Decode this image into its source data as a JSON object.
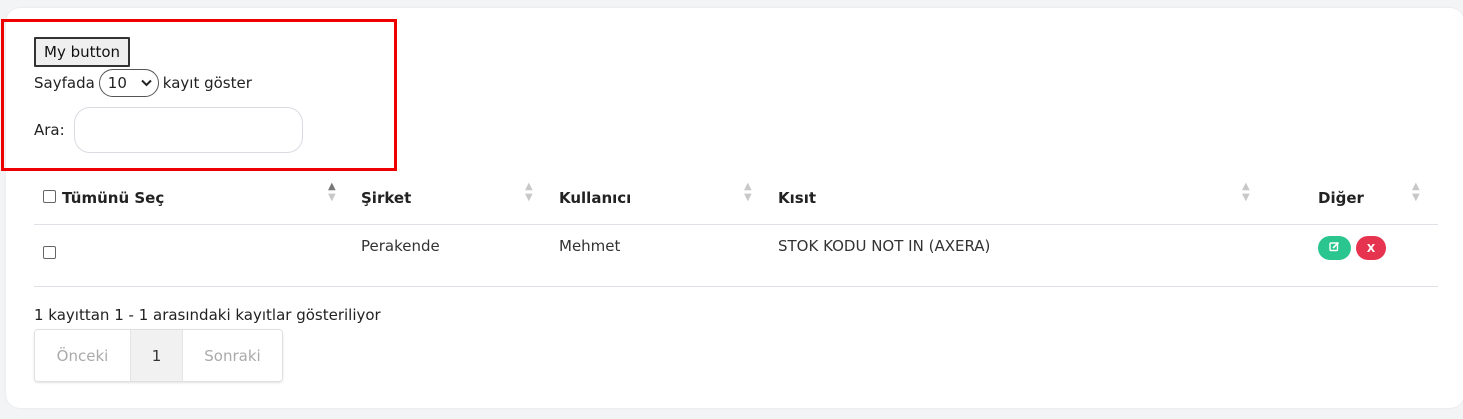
{
  "toolbar": {
    "my_button_label": "My button",
    "length_prefix": "Sayfada",
    "length_value": "10",
    "length_suffix": "kayıt göster",
    "search_label": "Ara:",
    "search_value": ""
  },
  "table": {
    "columns": [
      {
        "label": "Tümünü Seç"
      },
      {
        "label": "Şirket"
      },
      {
        "label": "Kullanıcı"
      },
      {
        "label": "Kısıt"
      },
      {
        "label": "Diğer"
      }
    ],
    "rows": [
      {
        "sirket": "Perakende",
        "kullanici": "Mehmet",
        "kisit": "STOK KODU NOT IN (AXERA)",
        "edit_icon": "edit-icon",
        "delete_label": "X"
      }
    ]
  },
  "footer": {
    "info": "1 kayıttan 1 - 1 arasındaki kayıtlar gösteriliyor",
    "prev_label": "Önceki",
    "page": "1",
    "next_label": "Sonraki"
  },
  "colors": {
    "highlight": "#ee0000",
    "edit": "#2bc58f",
    "delete": "#e6344f"
  }
}
